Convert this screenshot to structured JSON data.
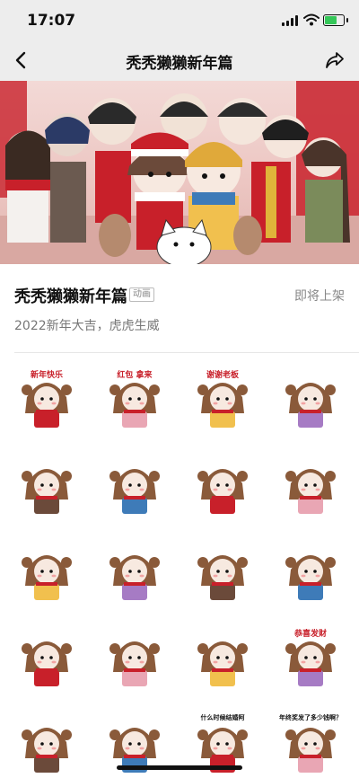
{
  "status_bar": {
    "time": "17:07"
  },
  "nav": {
    "title": "秃秃獭獭新年篇"
  },
  "pack": {
    "name": "秃秃獭獭新年篇",
    "tag": "动画",
    "status": "即将上架",
    "description": "2022新年大吉，虎虎生威"
  },
  "stickers": [
    {
      "caption": "新年快乐",
      "theme": "greeting"
    },
    {
      "caption": "红包 拿来",
      "theme": "red-envelope"
    },
    {
      "caption": "谢谢老板",
      "theme": "thanks"
    },
    {
      "caption": "",
      "theme": "dragon-dance"
    },
    {
      "caption": "",
      "theme": "lion-dance"
    },
    {
      "caption": "",
      "theme": "firecrackers"
    },
    {
      "caption": "",
      "theme": "feast"
    },
    {
      "caption": "",
      "theme": "scarf"
    },
    {
      "caption": "",
      "theme": "plum-blossom"
    },
    {
      "caption": "",
      "theme": "blessing"
    },
    {
      "caption": "",
      "theme": "hooded-blanket"
    },
    {
      "caption": "",
      "theme": "holding-red-packet"
    },
    {
      "caption": "",
      "theme": "shy"
    },
    {
      "caption": "",
      "theme": "window-peek"
    },
    {
      "caption": "",
      "theme": "door-couplet"
    },
    {
      "caption": "恭喜发财",
      "theme": "fortune"
    },
    {
      "caption": "",
      "theme": "gold-ingot"
    },
    {
      "caption": "",
      "theme": "tiger-hat"
    },
    {
      "caption": "什么时候结婚阿",
      "theme": "asking-marriage"
    },
    {
      "caption": "年终奖发了多少钱啊？",
      "theme": "year-end-bonus"
    }
  ],
  "colors": {
    "nav_bg": "#ededed",
    "accent_red": "#c8202a",
    "muted": "#888888"
  },
  "icons": {
    "back": "chevron-left-icon",
    "share": "share-icon"
  }
}
